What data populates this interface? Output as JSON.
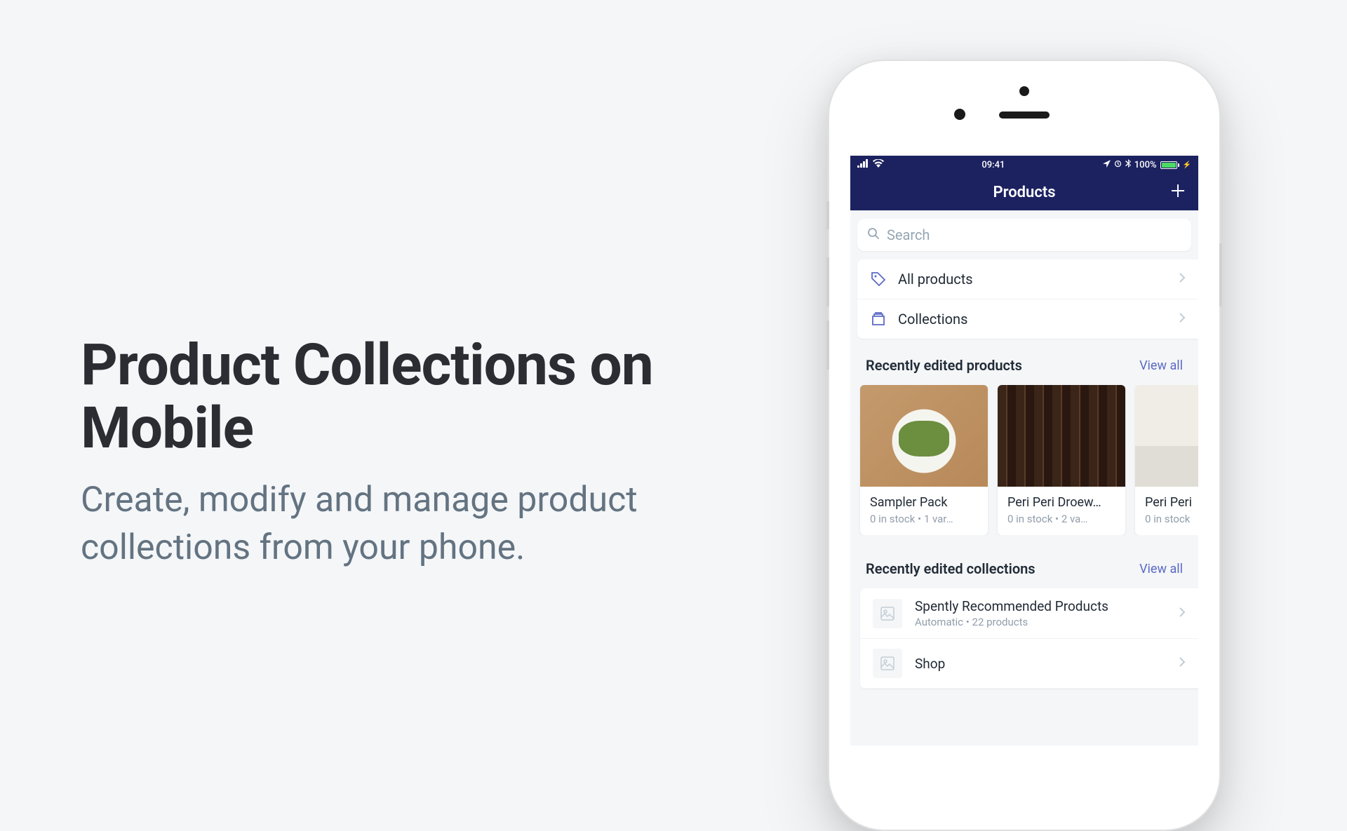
{
  "hero": {
    "title": "Product Collections on Mobile",
    "subtitle": "Create, modify and manage product collections from your phone."
  },
  "statusBar": {
    "time": "09:41",
    "battery": "100%"
  },
  "navBar": {
    "title": "Products"
  },
  "search": {
    "placeholder": "Search"
  },
  "menu": {
    "allProducts": "All products",
    "collections": "Collections"
  },
  "recentProducts": {
    "title": "Recently edited products",
    "viewAll": "View all",
    "items": [
      {
        "name": "Sampler Pack",
        "meta": "0 in stock  •  1 var…"
      },
      {
        "name": "Peri Peri Droew…",
        "meta": "0 in stock  •  2 va…"
      },
      {
        "name": "Peri Peri",
        "meta": "0 in stock"
      }
    ]
  },
  "recentCollections": {
    "title": "Recently edited collections",
    "viewAll": "View all",
    "items": [
      {
        "name": "Spently Recommended Products",
        "meta": "Automatic • 22 products"
      },
      {
        "name": "Shop",
        "meta": ""
      }
    ]
  },
  "colors": {
    "navBackground": "#1c2260",
    "accent": "#5c6ac4"
  }
}
